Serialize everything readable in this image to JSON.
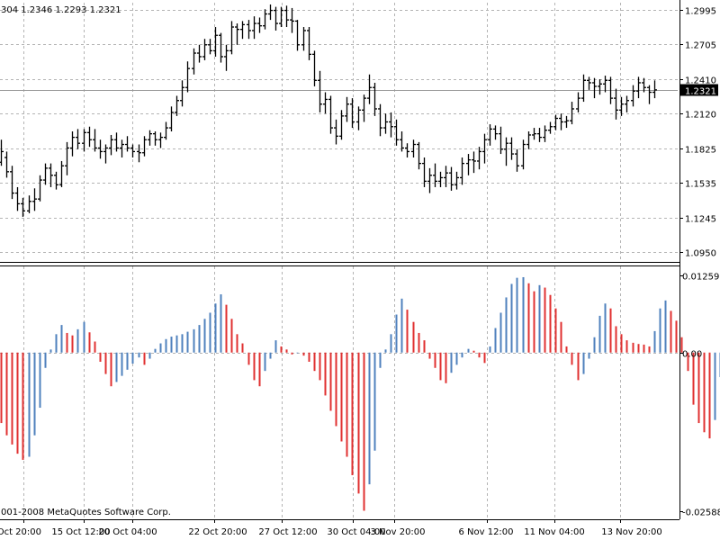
{
  "header": {
    "ohlc_text": "304 1.2346 1.2293 1.2321"
  },
  "copyright": "001-2008 MetaQuotes Software Corp.",
  "colors": {
    "background": "#ffffff",
    "grid": "#b4b4b4",
    "bar": "#000000",
    "hist_up": "#4f81bd",
    "hist_down": "#e03030",
    "price_tag_bg": "#000000",
    "current_price_line": "#9a9a9a"
  },
  "chart_data": [
    {
      "type": "ohlc",
      "panel": "price",
      "current_price": 1.2321,
      "current_price_label": "1.2321",
      "ylim": [
        1.087,
        1.3055
      ],
      "y_ticks": [
        1.2995,
        1.2705,
        1.241,
        1.212,
        1.1825,
        1.1535,
        1.1245,
        1.095
      ],
      "y_tick_labels": [
        "1.2995",
        "1.2705",
        "1.2410",
        "1.2120",
        "1.1825",
        "1.1535",
        "1.1245",
        "1.0950"
      ],
      "grid": true,
      "bars": [
        [
          1.171,
          1.19,
          1.168,
          1.18
        ],
        [
          1.175,
          1.18,
          1.158,
          1.163
        ],
        [
          1.163,
          1.168,
          1.14,
          1.145
        ],
        [
          1.145,
          1.15,
          1.13,
          1.136
        ],
        [
          1.136,
          1.141,
          1.125,
          1.13
        ],
        [
          1.13,
          1.143,
          1.128,
          1.138
        ],
        [
          1.138,
          1.149,
          1.13,
          1.14
        ],
        [
          1.14,
          1.16,
          1.138,
          1.156
        ],
        [
          1.156,
          1.17,
          1.152,
          1.166
        ],
        [
          1.166,
          1.17,
          1.15,
          1.16
        ],
        [
          1.16,
          1.163,
          1.148,
          1.152
        ],
        [
          1.152,
          1.172,
          1.15,
          1.168
        ],
        [
          1.168,
          1.188,
          1.16,
          1.183
        ],
        [
          1.183,
          1.197,
          1.176,
          1.192
        ],
        [
          1.192,
          1.199,
          1.182,
          1.187
        ],
        [
          1.187,
          1.199,
          1.18,
          1.196
        ],
        [
          1.196,
          1.201,
          1.184,
          1.19
        ],
        [
          1.19,
          1.199,
          1.18,
          1.183
        ],
        [
          1.183,
          1.19,
          1.174,
          1.18
        ],
        [
          1.18,
          1.186,
          1.17,
          1.183
        ],
        [
          1.183,
          1.194,
          1.177,
          1.19
        ],
        [
          1.19,
          1.196,
          1.18,
          1.183
        ],
        [
          1.183,
          1.19,
          1.175,
          1.186
        ],
        [
          1.186,
          1.193,
          1.18,
          1.183
        ],
        [
          1.183,
          1.186,
          1.175,
          1.18
        ],
        [
          1.18,
          1.186,
          1.171,
          1.179
        ],
        [
          1.179,
          1.193,
          1.176,
          1.19
        ],
        [
          1.19,
          1.198,
          1.185,
          1.195
        ],
        [
          1.195,
          1.197,
          1.185,
          1.19
        ],
        [
          1.19,
          1.196,
          1.183,
          1.192
        ],
        [
          1.192,
          1.205,
          1.19,
          1.2
        ],
        [
          1.2,
          1.218,
          1.197,
          1.213
        ],
        [
          1.213,
          1.227,
          1.21,
          1.223
        ],
        [
          1.223,
          1.24,
          1.218,
          1.234
        ],
        [
          1.234,
          1.256,
          1.23,
          1.25
        ],
        [
          1.25,
          1.267,
          1.245,
          1.263
        ],
        [
          1.263,
          1.27,
          1.255,
          1.26
        ],
        [
          1.26,
          1.275,
          1.257,
          1.27
        ],
        [
          1.27,
          1.275,
          1.262,
          1.265
        ],
        [
          1.265,
          1.285,
          1.26,
          1.278
        ],
        [
          1.278,
          1.28,
          1.255,
          1.26
        ],
        [
          1.26,
          1.27,
          1.248,
          1.265
        ],
        [
          1.265,
          1.29,
          1.262,
          1.285
        ],
        [
          1.285,
          1.288,
          1.27,
          1.283
        ],
        [
          1.283,
          1.29,
          1.275,
          1.287
        ],
        [
          1.287,
          1.291,
          1.275,
          1.282
        ],
        [
          1.282,
          1.294,
          1.275,
          1.288
        ],
        [
          1.288,
          1.293,
          1.28,
          1.286
        ],
        [
          1.286,
          1.3,
          1.283,
          1.296
        ],
        [
          1.296,
          1.304,
          1.291,
          1.299
        ],
        [
          1.299,
          1.302,
          1.282,
          1.288
        ],
        [
          1.288,
          1.302,
          1.285,
          1.299
        ],
        [
          1.299,
          1.303,
          1.285,
          1.291
        ],
        [
          1.291,
          1.301,
          1.28,
          1.29
        ],
        [
          1.29,
          1.291,
          1.265,
          1.27
        ],
        [
          1.27,
          1.285,
          1.265,
          1.282
        ],
        [
          1.282,
          1.285,
          1.257,
          1.262
        ],
        [
          1.262,
          1.265,
          1.235,
          1.24
        ],
        [
          1.24,
          1.248,
          1.213,
          1.22
        ],
        [
          1.22,
          1.23,
          1.212,
          1.224
        ],
        [
          1.224,
          1.227,
          1.195,
          1.2
        ],
        [
          1.2,
          1.207,
          1.186,
          1.193
        ],
        [
          1.193,
          1.215,
          1.19,
          1.21
        ],
        [
          1.21,
          1.226,
          1.205,
          1.22
        ],
        [
          1.22,
          1.225,
          1.2,
          1.205
        ],
        [
          1.205,
          1.218,
          1.198,
          1.215
        ],
        [
          1.215,
          1.228,
          1.205,
          1.225
        ],
        [
          1.225,
          1.245,
          1.22,
          1.234
        ],
        [
          1.234,
          1.238,
          1.21,
          1.216
        ],
        [
          1.216,
          1.22,
          1.193,
          1.2
        ],
        [
          1.2,
          1.212,
          1.195,
          1.205
        ],
        [
          1.205,
          1.213,
          1.192,
          1.201
        ],
        [
          1.201,
          1.207,
          1.185,
          1.19
        ],
        [
          1.19,
          1.197,
          1.18,
          1.183
        ],
        [
          1.183,
          1.187,
          1.175,
          1.18
        ],
        [
          1.18,
          1.19,
          1.175,
          1.186
        ],
        [
          1.186,
          1.188,
          1.165,
          1.17
        ],
        [
          1.17,
          1.175,
          1.15,
          1.155
        ],
        [
          1.155,
          1.166,
          1.145,
          1.16
        ],
        [
          1.16,
          1.17,
          1.15,
          1.155
        ],
        [
          1.155,
          1.163,
          1.15,
          1.158
        ],
        [
          1.158,
          1.168,
          1.15,
          1.162
        ],
        [
          1.162,
          1.167,
          1.147,
          1.152
        ],
        [
          1.152,
          1.163,
          1.148,
          1.158
        ],
        [
          1.158,
          1.175,
          1.152,
          1.17
        ],
        [
          1.17,
          1.178,
          1.16,
          1.173
        ],
        [
          1.173,
          1.18,
          1.162,
          1.172
        ],
        [
          1.172,
          1.184,
          1.165,
          1.18
        ],
        [
          1.18,
          1.195,
          1.17,
          1.19
        ],
        [
          1.19,
          1.203,
          1.185,
          1.199
        ],
        [
          1.199,
          1.202,
          1.19,
          1.195
        ],
        [
          1.195,
          1.201,
          1.178,
          1.182
        ],
        [
          1.182,
          1.192,
          1.168,
          1.187
        ],
        [
          1.187,
          1.192,
          1.173,
          1.178
        ],
        [
          1.178,
          1.182,
          1.163,
          1.168
        ],
        [
          1.168,
          1.19,
          1.165,
          1.186
        ],
        [
          1.186,
          1.197,
          1.182,
          1.194
        ],
        [
          1.194,
          1.2,
          1.19,
          1.195
        ],
        [
          1.195,
          1.2,
          1.188,
          1.192
        ],
        [
          1.192,
          1.202,
          1.188,
          1.198
        ],
        [
          1.198,
          1.205,
          1.195,
          1.201
        ],
        [
          1.201,
          1.211,
          1.198,
          1.208
        ],
        [
          1.208,
          1.212,
          1.198,
          1.205
        ],
        [
          1.205,
          1.21,
          1.2,
          1.206
        ],
        [
          1.206,
          1.222,
          1.203,
          1.216
        ],
        [
          1.216,
          1.23,
          1.213,
          1.225
        ],
        [
          1.225,
          1.245,
          1.222,
          1.24
        ],
        [
          1.24,
          1.243,
          1.232,
          1.238
        ],
        [
          1.238,
          1.242,
          1.225,
          1.235
        ],
        [
          1.235,
          1.241,
          1.228,
          1.237
        ],
        [
          1.237,
          1.244,
          1.23,
          1.24
        ],
        [
          1.24,
          1.243,
          1.22,
          1.225
        ],
        [
          1.225,
          1.233,
          1.207,
          1.215
        ],
        [
          1.215,
          1.226,
          1.21,
          1.22
        ],
        [
          1.22,
          1.227,
          1.213,
          1.223
        ],
        [
          1.223,
          1.236,
          1.218,
          1.231
        ],
        [
          1.231,
          1.243,
          1.225,
          1.238
        ],
        [
          1.238,
          1.242,
          1.23,
          1.234
        ],
        [
          1.234,
          1.236,
          1.22,
          1.23
        ],
        [
          1.23,
          1.24,
          1.225,
          1.232
        ]
      ]
    },
    {
      "type": "histogram",
      "panel": "oscillator",
      "ylim": [
        -0.02588,
        0.01259
      ],
      "y_ticks": [
        0.01259,
        0.0,
        -0.02588
      ],
      "y_tick_labels": [
        "0.012599",
        "0.00",
        "-0.02588"
      ],
      "grid": true,
      "colors_note": "red = falling vs previous bar, blue = rising",
      "values": [
        -0.0115,
        -0.0135,
        -0.015,
        -0.0165,
        -0.0175,
        -0.017,
        -0.0135,
        -0.009,
        -0.0025,
        0.0005,
        0.003,
        0.0045,
        0.0032,
        0.0028,
        0.0038,
        0.005,
        0.0033,
        0.0018,
        -0.0015,
        -0.0035,
        -0.0055,
        -0.0048,
        -0.0038,
        -0.0028,
        -0.0018,
        -0.0008,
        -0.002,
        -0.001,
        0.0006,
        0.0015,
        0.0022,
        0.0026,
        0.0028,
        0.003,
        0.0034,
        0.0038,
        0.0045,
        0.0055,
        0.0065,
        0.008,
        0.0095,
        0.0078,
        0.0055,
        0.003,
        0.0015,
        -0.002,
        -0.0045,
        -0.0055,
        -0.003,
        -0.001,
        0.002,
        0.001,
        0.0005,
        -0.0003,
        -0.0001,
        -0.0005,
        -0.0015,
        -0.003,
        -0.0045,
        -0.007,
        -0.0095,
        -0.012,
        -0.0145,
        -0.017,
        -0.02,
        -0.023,
        -0.0258,
        -0.0215,
        -0.016,
        -0.0025,
        0.0005,
        0.003,
        0.0062,
        0.0088,
        0.007,
        0.005,
        0.0032,
        0.002,
        -0.001,
        -0.0025,
        -0.0045,
        -0.005,
        -0.0033,
        -0.002,
        -0.0008,
        0.0006,
        0.0003,
        -0.0008,
        -0.0017,
        0.001,
        0.004,
        0.0065,
        0.009,
        0.0112,
        0.0122,
        0.0123,
        0.0113,
        0.01,
        0.011,
        0.0106,
        0.0094,
        0.0072,
        0.005,
        0.001,
        -0.002,
        -0.0045,
        -0.0035,
        -0.001,
        0.0025,
        0.006,
        0.008,
        0.0072,
        0.0043,
        0.003,
        0.002,
        0.0016,
        0.0014,
        0.0013,
        0.001,
        0.0035,
        0.0072,
        0.0085,
        0.0068,
        0.0052,
        0.0025,
        -0.003,
        -0.0085,
        -0.0115,
        -0.013,
        -0.014,
        -0.011,
        -0.004,
        0.0025,
        0.0045,
        0.003
      ]
    }
  ],
  "x_axis": {
    "tick_labels": [
      "Oct 20:00",
      "15 Oct 12:00",
      "20 Oct 04:00",
      "22 Oct 20:00",
      "27 Oct 12:00",
      "30 Oct 04:00",
      "3 Nov 20:00",
      "6 Nov 12:00",
      "11 Nov 04:00",
      "13 Nov 20:00"
    ]
  }
}
